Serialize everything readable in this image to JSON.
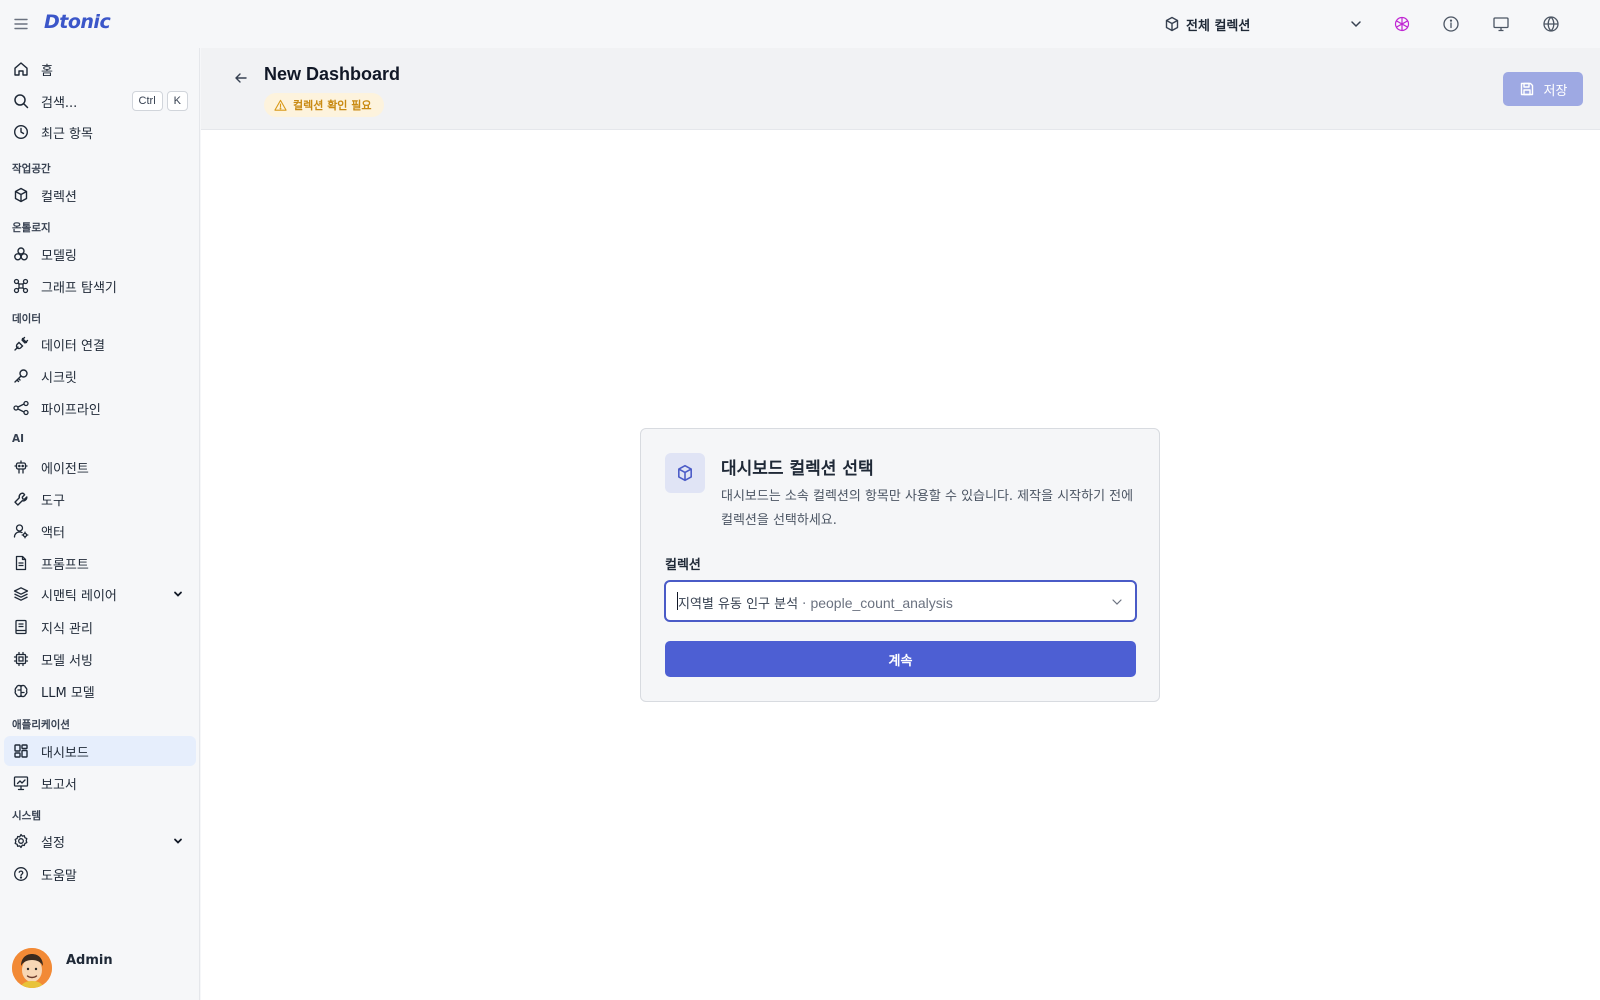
{
  "app": {
    "logo_text": "Dtonic"
  },
  "topbar": {
    "collection_label": "전체 컬렉션",
    "icons": [
      "graph-network-icon",
      "info-icon",
      "monitor-icon",
      "globe-icon"
    ]
  },
  "sidebar": {
    "home": "홈",
    "search": "검색...",
    "search_kbd_ctrl": "Ctrl",
    "search_kbd_k": "K",
    "recent": "최근 항목",
    "sections": {
      "workspace": "작업공간",
      "ontology": "온톨로지",
      "data": "데이터",
      "ai": "AI",
      "application": "애플리케이션",
      "system": "시스템"
    },
    "collection": "컬렉션",
    "modeling": "모델링",
    "graph_explorer": "그래프 탐색기",
    "data_connection": "데이터 연결",
    "secret": "시크릿",
    "pipeline": "파이프라인",
    "agent": "에이전트",
    "tool": "도구",
    "actor": "액터",
    "prompt": "프롬프트",
    "semantic_layer": "시맨틱 레이어",
    "knowledge": "지식 관리",
    "model_serving": "모델 서빙",
    "llm_model": "LLM 모델",
    "dashboard": "대시보드",
    "report": "보고서",
    "settings": "설정",
    "help": "도움말",
    "user_name": "Admin"
  },
  "header": {
    "title": "New Dashboard",
    "warning_badge": "컬렉션 확인 필요",
    "save_label": "저장"
  },
  "dialog": {
    "title": "대시보드 컬렉션 선택",
    "description": "대시보드는 소속 컬렉션의 항목만 사용할 수 있습니다. 제작을 시작하기 전에 컬렉션을 선택하세요.",
    "field_label": "컬렉션",
    "selected_name": "지역별 유동 인구 분석",
    "separator": " · ",
    "selected_code": "people_count_analysis",
    "continue_label": "계속"
  },
  "colors": {
    "accent": "#4d5fd3",
    "logo": "#3b56c9",
    "warning": "#d99a1a",
    "active_nav_bg": "#e6eefc"
  }
}
